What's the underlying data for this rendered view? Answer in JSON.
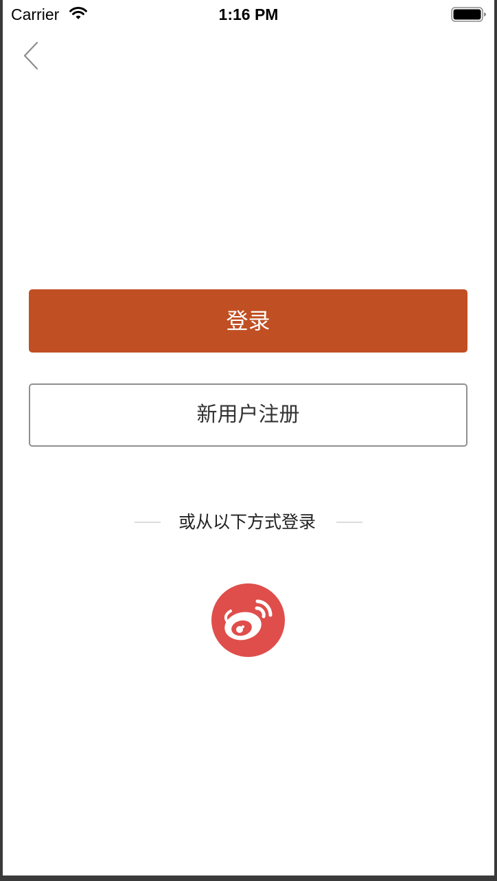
{
  "status_bar": {
    "carrier": "Carrier",
    "time": "1:16 PM",
    "wifi_icon": "wifi-icon",
    "battery_icon": "battery-icon"
  },
  "nav": {
    "back_icon": "chevron-left-icon"
  },
  "buttons": {
    "login_label": "登录",
    "register_label": "新用户注册"
  },
  "social": {
    "divider_text": "或从以下方式登录",
    "weibo_icon": "weibo-icon"
  },
  "colors": {
    "login_button": "#c04f23",
    "weibo": "#df4e4b",
    "register_border": "#8f8f8f"
  }
}
